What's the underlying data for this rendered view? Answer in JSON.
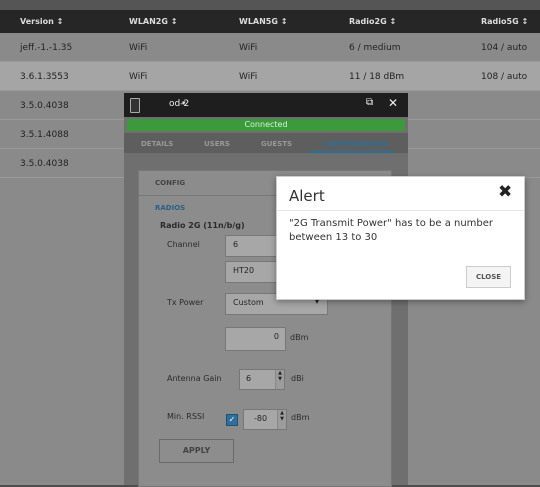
{
  "table": {
    "headers": [
      "Version ↕",
      "WLAN2G ↕",
      "WLAN5G ↕",
      "Radio2G ↕",
      "Radio5G ↕"
    ],
    "rows": [
      {
        "version": "jeff.-1.-1.35",
        "wlan2g": "WiFi",
        "wlan5g": "WiFi",
        "radio2g": "6 / medium",
        "radio5g": "104 / auto"
      },
      {
        "version": "3.6.1.3553",
        "wlan2g": "WiFi",
        "wlan5g": "WiFi",
        "radio2g": "11 / 18 dBm",
        "radio5g": "108 / auto"
      },
      {
        "version": "3.5.0.4038"
      },
      {
        "version": "3.5.1.4088"
      },
      {
        "version": "3.5.0.4038"
      }
    ]
  },
  "panel": {
    "device_name": "od-2",
    "caret": "▾",
    "popout_icon": "⧉",
    "close_icon": "✕",
    "status": "Connected",
    "tabs": [
      "DETAILS",
      "USERS",
      "GUESTS",
      "CONFIGURATION"
    ],
    "config_heading": "CONFIG",
    "radios_heading": "RADIOS",
    "radio_title": "Radio 2G (11n/b/g)",
    "channel_label": "Channel",
    "channel_value": "6",
    "ht_value": "HT20",
    "txpower_label": "Tx Power",
    "txpower_value": "Custom",
    "txpower_dbm": "0",
    "dbm_unit": "dBm",
    "antenna_label": "Antenna Gain",
    "antenna_value": "6",
    "dbi_unit": "dBi",
    "rssi_label": "Min. RSSI",
    "rssi_checked": "✓",
    "rssi_value": "-80",
    "apply_label": "APPLY"
  },
  "alert": {
    "title": "Alert",
    "close_icon": "✖",
    "message": "\"2G Transmit Power\" has to be a number between 13 to 30",
    "button": "CLOSE"
  }
}
